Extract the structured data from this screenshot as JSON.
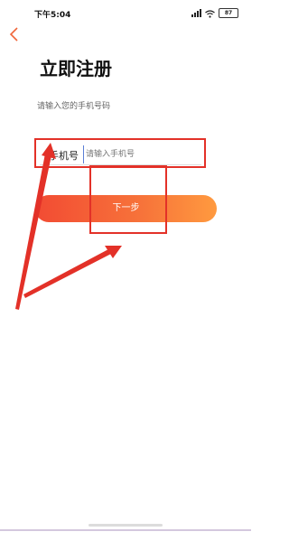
{
  "status_bar": {
    "time": "下午5:04",
    "battery": "87"
  },
  "header": {
    "title": "立即注册",
    "subtitle": "请输入您的手机号码"
  },
  "form": {
    "phone_label": "手机号",
    "phone_placeholder": "请输入手机号",
    "phone_value": ""
  },
  "actions": {
    "next_label": "下一步"
  },
  "colors": {
    "accent_start": "#f24b33",
    "accent_end": "#ff9a3f",
    "annotation_red": "#e33128"
  }
}
